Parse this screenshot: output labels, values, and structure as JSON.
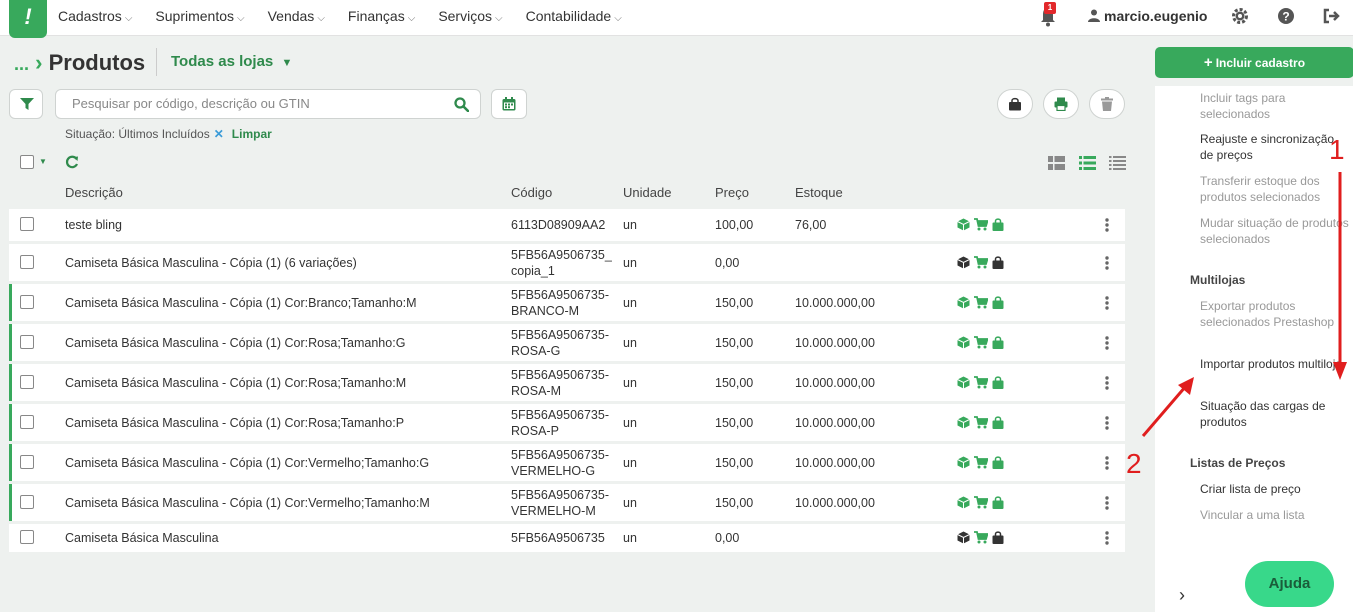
{
  "app": {
    "logo": "!",
    "menu": [
      {
        "label": "Cadastros"
      },
      {
        "label": "Suprimentos"
      },
      {
        "label": "Vendas"
      },
      {
        "label": "Finanças"
      },
      {
        "label": "Serviços"
      },
      {
        "label": "Contabilidade"
      }
    ],
    "notifications": "1",
    "user": "marcio.eugenio"
  },
  "header": {
    "breadcrumb_dots": "...",
    "title": "Produtos",
    "store_selector": "Todas as lojas"
  },
  "search": {
    "placeholder": "Pesquisar por código, descrição ou GTIN"
  },
  "filter": {
    "situation": "Situação: Últimos Incluídos",
    "clear": "Limpar"
  },
  "table": {
    "columns": [
      "Descrição",
      "Código",
      "Unidade",
      "Preço",
      "Estoque"
    ],
    "rows": [
      {
        "desc": "teste bling",
        "extra": "",
        "code1": "6113D08909AA2",
        "code2": "",
        "unit": "un",
        "price": "100,00",
        "stock": "76,00",
        "variant": false,
        "icons": "green"
      },
      {
        "desc": "Camiseta Básica Masculina - Cópia (1)",
        "extra": "(6 variações)",
        "code1": "5FB56A9506735_",
        "code2": "copia_1",
        "unit": "un",
        "price": "0,00",
        "stock": "",
        "variant": false,
        "icons": "mixed"
      },
      {
        "desc": "Camiseta Básica Masculina - Cópia (1) Cor:Branco;Tamanho:M",
        "extra": "",
        "code1": "5FB56A9506735-",
        "code2": "BRANCO-M",
        "unit": "un",
        "price": "150,00",
        "stock": "10.000.000,00",
        "variant": true,
        "icons": "green"
      },
      {
        "desc": "Camiseta Básica Masculina - Cópia (1) Cor:Rosa;Tamanho:G",
        "extra": "",
        "code1": "5FB56A9506735-",
        "code2": "ROSA-G",
        "unit": "un",
        "price": "150,00",
        "stock": "10.000.000,00",
        "variant": true,
        "icons": "green"
      },
      {
        "desc": "Camiseta Básica Masculina - Cópia (1) Cor:Rosa;Tamanho:M",
        "extra": "",
        "code1": "5FB56A9506735-",
        "code2": "ROSA-M",
        "unit": "un",
        "price": "150,00",
        "stock": "10.000.000,00",
        "variant": true,
        "icons": "green"
      },
      {
        "desc": "Camiseta Básica Masculina - Cópia (1) Cor:Rosa;Tamanho:P",
        "extra": "",
        "code1": "5FB56A9506735-",
        "code2": "ROSA-P",
        "unit": "un",
        "price": "150,00",
        "stock": "10.000.000,00",
        "variant": true,
        "icons": "green"
      },
      {
        "desc": "Camiseta Básica Masculina - Cópia (1) Cor:Vermelho;Tamanho:G",
        "extra": "",
        "code1": "5FB56A9506735-",
        "code2": "VERMELHO-G",
        "unit": "un",
        "price": "150,00",
        "stock": "10.000.000,00",
        "variant": true,
        "icons": "green"
      },
      {
        "desc": "Camiseta Básica Masculina - Cópia (1) Cor:Vermelho;Tamanho:M",
        "extra": "",
        "code1": "5FB56A9506735-",
        "code2": "VERMELHO-M",
        "unit": "un",
        "price": "150,00",
        "stock": "10.000.000,00",
        "variant": true,
        "icons": "green"
      },
      {
        "desc": "Camiseta Básica Masculina",
        "extra": "",
        "code1": "5FB56A9506735",
        "code2": "",
        "unit": "un",
        "price": "0,00",
        "stock": "",
        "variant": false,
        "icons": "mixed"
      }
    ]
  },
  "side": {
    "add_button": "Incluir cadastro",
    "items": [
      {
        "label": "Incluir tags para selecionados",
        "enabled": false
      },
      {
        "label": "Reajuste e sincronização de preços",
        "enabled": true
      },
      {
        "label": "Transferir estoque dos produtos selecionados",
        "enabled": false
      },
      {
        "label": "Mudar situação de produtos selecionados",
        "enabled": false
      }
    ],
    "section_multilojas": "Multilojas",
    "multilojas": [
      {
        "label": "Exportar produtos selecionados Prestashop",
        "enabled": false
      },
      {
        "label": "Importar produtos multiloja",
        "enabled": true
      },
      {
        "label": "Situação das cargas de produtos",
        "enabled": true
      }
    ],
    "section_precos": "Listas de Preços",
    "precos": [
      {
        "label": "Criar lista de preço",
        "enabled": true
      },
      {
        "label": "Vincular a uma lista",
        "enabled": false
      }
    ],
    "help": "Ajuda"
  },
  "annotations": {
    "one": "1",
    "two": "2"
  },
  "colors": {
    "accent": "#38a95c",
    "danger": "#e01e1e",
    "help": "#38d88a"
  }
}
